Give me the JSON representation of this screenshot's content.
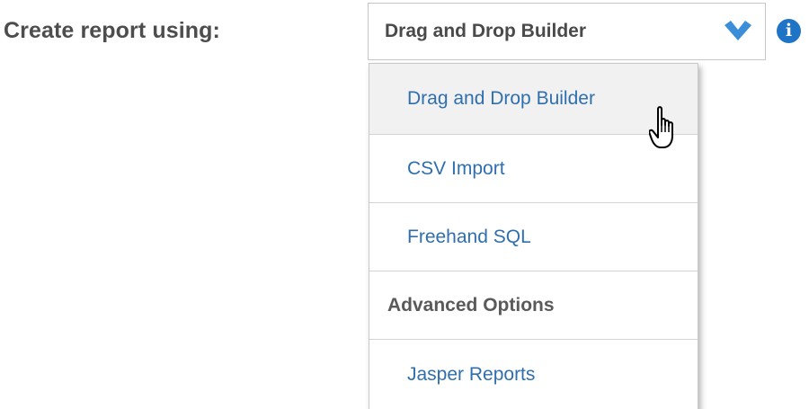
{
  "form": {
    "label": "Create report using:"
  },
  "select": {
    "selected_value": "Drag and Drop Builder",
    "arrow_icon": "chevron-down-icon",
    "arrow_color": "#3b8fd9"
  },
  "info": {
    "icon": "info-icon",
    "glyph": "i",
    "color": "#1f74c6"
  },
  "dropdown": {
    "items": [
      {
        "label": "Drag and Drop Builder",
        "type": "option",
        "hovered": true
      },
      {
        "label": "CSV Import",
        "type": "option",
        "hovered": false
      },
      {
        "label": "Freehand SQL",
        "type": "option",
        "hovered": false
      },
      {
        "label": "Advanced Options",
        "type": "header",
        "hovered": false
      },
      {
        "label": "Jasper Reports",
        "type": "option",
        "hovered": false
      }
    ]
  },
  "colors": {
    "link_text": "#2f6fae",
    "label_text": "#4d4d4d",
    "hover_background": "#f1f1f1",
    "border": "#c9c9c9"
  },
  "cursor": {
    "icon": "hand-pointer-cursor-icon"
  }
}
